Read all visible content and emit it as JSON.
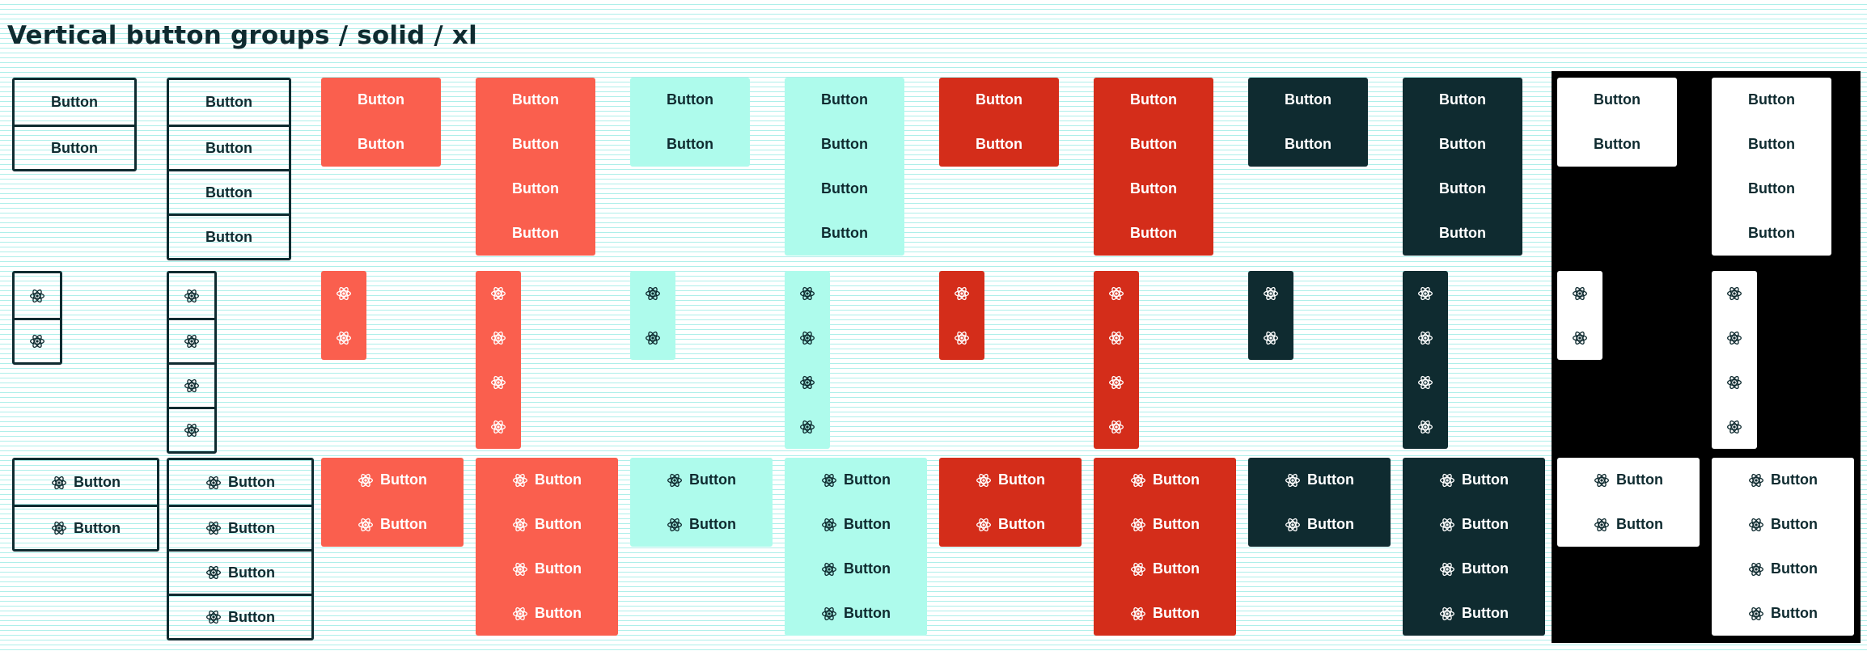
{
  "page": {
    "title": "Vertical button groups / solid / xl"
  },
  "button_label": "Button",
  "icon": "atom-icon",
  "colors": {
    "outline": "#0f2b30",
    "coral": "#fa5f4e",
    "mint": "#aefbec",
    "red": "#d42d1a",
    "navy": "#0f2b30",
    "white": "#ffffff",
    "dark_background": "#000000"
  },
  "variants": [
    "outline",
    "outline",
    "coral",
    "coral",
    "mint",
    "mint",
    "red",
    "red",
    "navy",
    "navy",
    "white",
    "white"
  ],
  "button_counts": [
    2,
    4,
    2,
    4,
    2,
    4,
    2,
    4,
    2,
    4,
    2,
    4
  ],
  "rows": [
    "text-only",
    "icon-only",
    "icon-and-text"
  ]
}
